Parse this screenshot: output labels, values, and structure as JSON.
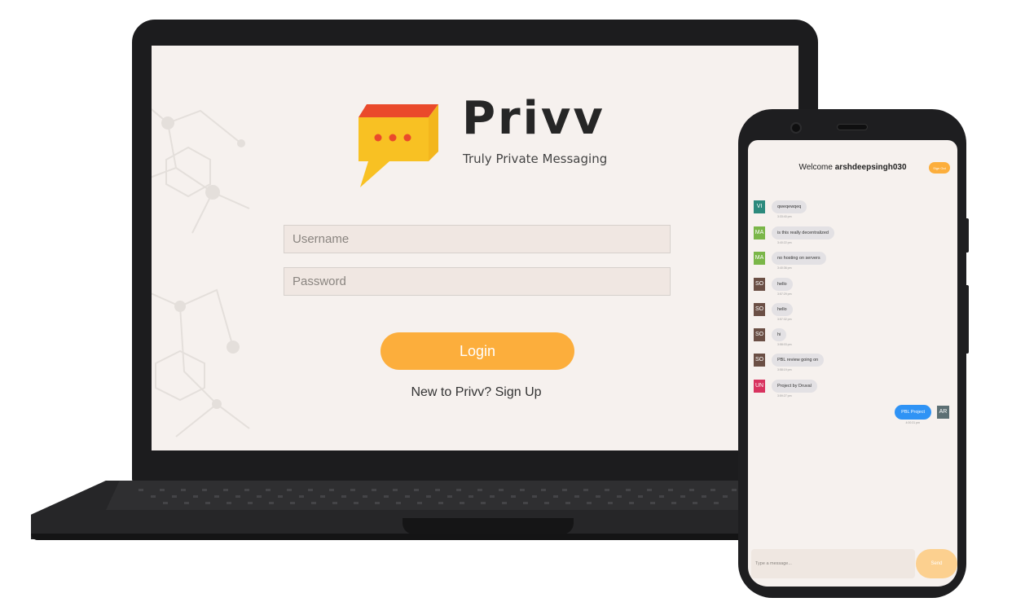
{
  "laptop": {
    "brand_name": "Privv",
    "tagline": "Truly Private Messaging",
    "username_placeholder": "Username",
    "password_placeholder": "Password",
    "login_label": "Login",
    "signup_text": "New to Privv? Sign Up"
  },
  "phone": {
    "welcome_prefix": "Welcome",
    "username": "arshdeepsingh030",
    "signout_label": "Sign Out",
    "messages": [
      {
        "initials": "VI",
        "text": "qweqewqeq",
        "time": "3:33:40 pm"
      },
      {
        "initials": "MA",
        "text": "is this really decentralized",
        "time": "3:40:22 pm"
      },
      {
        "initials": "MA",
        "text": "no hosting on servers",
        "time": "3:40:36 pm"
      },
      {
        "initials": "SO",
        "text": "hello",
        "time": "3:57:29 pm"
      },
      {
        "initials": "SO",
        "text": "hello",
        "time": "3:57:32 pm"
      },
      {
        "initials": "SO",
        "text": "hi",
        "time": "3:58:03 pm"
      },
      {
        "initials": "SO",
        "text": "PBL review going on",
        "time": "3:58:19 pm"
      },
      {
        "initials": "UN",
        "text": "Project by Druval",
        "time": "3:59:27 pm"
      }
    ],
    "own_message": {
      "initials": "AR",
      "text": "PBL Project",
      "time": "4:00:31 pm"
    },
    "input_placeholder": "Type a message...",
    "send_label": "Send"
  },
  "colors": {
    "accent": "#fcae3c",
    "outgoing_bubble": "#2f93f5",
    "screen_bg": "#f6f1ee",
    "avatar_vi": "#2c8a7d",
    "avatar_ma": "#7ab648",
    "avatar_so": "#6b4f45",
    "avatar_un": "#d8335f",
    "avatar_ar": "#5c6f73"
  }
}
